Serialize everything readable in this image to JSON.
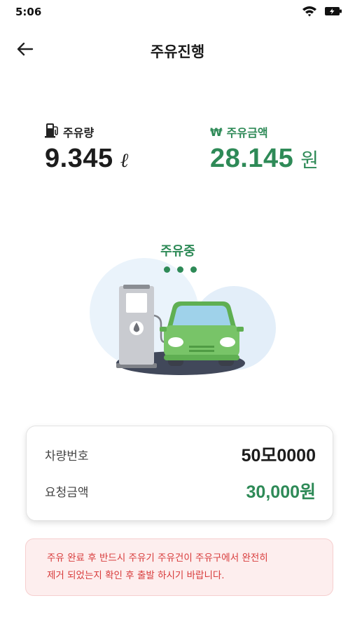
{
  "status_bar": {
    "time": "5:06",
    "icons": [
      "wifi-icon",
      "battery-icon"
    ]
  },
  "header": {
    "title": "주유진행",
    "back_icon": "back-arrow-icon"
  },
  "fuel_volume": {
    "icon": "fuel-pump-icon",
    "label": "주유량",
    "value": "9.345",
    "unit": "ℓ"
  },
  "fuel_amount": {
    "icon": "won-sign",
    "symbol": "₩",
    "label": "주유금액",
    "value": "28.145",
    "unit": "원"
  },
  "fueling_status": {
    "text": "주유중",
    "indicator": "three-dots"
  },
  "info_card": {
    "plate_label": "차량번호",
    "plate_value": "50모0000",
    "request_label": "요청금액",
    "request_value": "30,000원"
  },
  "notice": {
    "text": "주유 완료 후 반드시 주유기 주유건이 주유구에서 완전히\n제거 되었는지 확인 후 출발 하시기 바랍니다."
  },
  "colors": {
    "accent_green": "#2e8a57",
    "notice_red": "#d83b3b",
    "notice_bg": "#fdeeee",
    "car_body": "#78c468"
  }
}
